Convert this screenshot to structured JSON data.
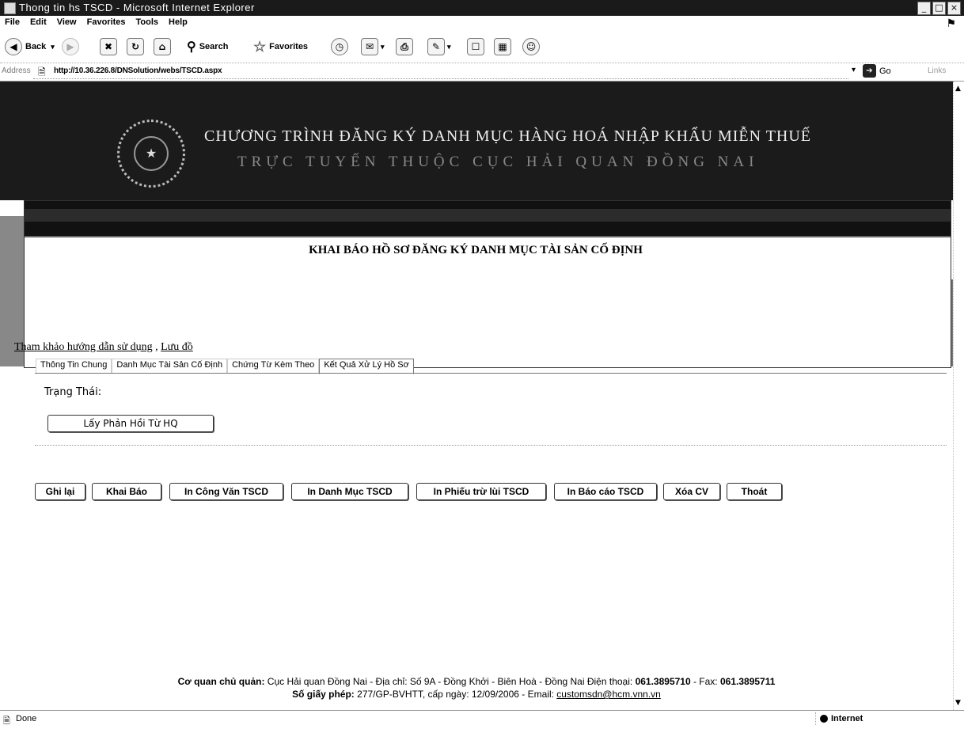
{
  "window": {
    "title": "Thong tin hs TSCD - Microsoft Internet Explorer",
    "controls": [
      "_",
      "□",
      "×"
    ]
  },
  "menu": [
    "File",
    "Edit",
    "View",
    "Favorites",
    "Tools",
    "Help"
  ],
  "toolbar": {
    "back": "Back",
    "search": "Search",
    "favorites": "Favorites"
  },
  "address": {
    "label": "Address",
    "url": "http://10.36.226.8/DNSolution/webs/TSCD.aspx",
    "go": "Go",
    "links": "Links"
  },
  "banner": {
    "line1": "CHƯƠNG TRÌNH ĐĂNG KÝ DANH MỤC HÀNG HOÁ NHẬP KHẨU MIỄN THUẾ",
    "line2": "TRỰC TUYẾN THUỘC CỤC HẢI QUAN ĐỒNG NAI"
  },
  "page": {
    "title": "KHAI BÁO HỒ SƠ ĐĂNG KÝ DANH MỤC TÀI SẢN CỐ ĐỊNH",
    "link_help": "Tham khảo hướng dẫn sử dụng",
    "link_sep": " , ",
    "link_flow": "Lưu đồ"
  },
  "tabs": [
    {
      "label": "Thông Tin Chung",
      "active": false
    },
    {
      "label": "Danh Mục Tài Sản Cố Định",
      "active": false
    },
    {
      "label": "Chứng Từ Kèm Theo",
      "active": false
    },
    {
      "label": "Kết Quả Xử Lý Hồ Sơ",
      "active": true
    }
  ],
  "result": {
    "status_label": "Trạng Thái:",
    "fetch_button": "Lấy Phản Hồi Từ HQ"
  },
  "actions": {
    "save": "Ghi lại",
    "declare": "Khai Báo",
    "print_letter": "In Công Văn TSCD",
    "print_list": "In Danh Mục TSCD",
    "print_deduct": "In Phiếu trừ lùi TSCD",
    "print_report": "In Báo cáo TSCD",
    "delete": "Xóa CV",
    "exit": "Thoát"
  },
  "footer": {
    "agency_label": "Cơ quan chủ quản:",
    "agency_text": " Cục Hải quan Đồng Nai - Địa chỉ: Số 9A - Đồng Khởi - Biên Hoà - Đồng Nai Điện thoại: ",
    "phone": "061.3895710",
    "fax_label": " - Fax: ",
    "fax": "061.3895711",
    "license_label": "Số giấy phép:",
    "license_text": " 277/GP-BVHTT, cấp ngày: 12/09/2006 - Email: ",
    "email": "customsdn@hcm.vnn.vn"
  },
  "statusbar": {
    "status": "Done",
    "zone": "Internet"
  }
}
